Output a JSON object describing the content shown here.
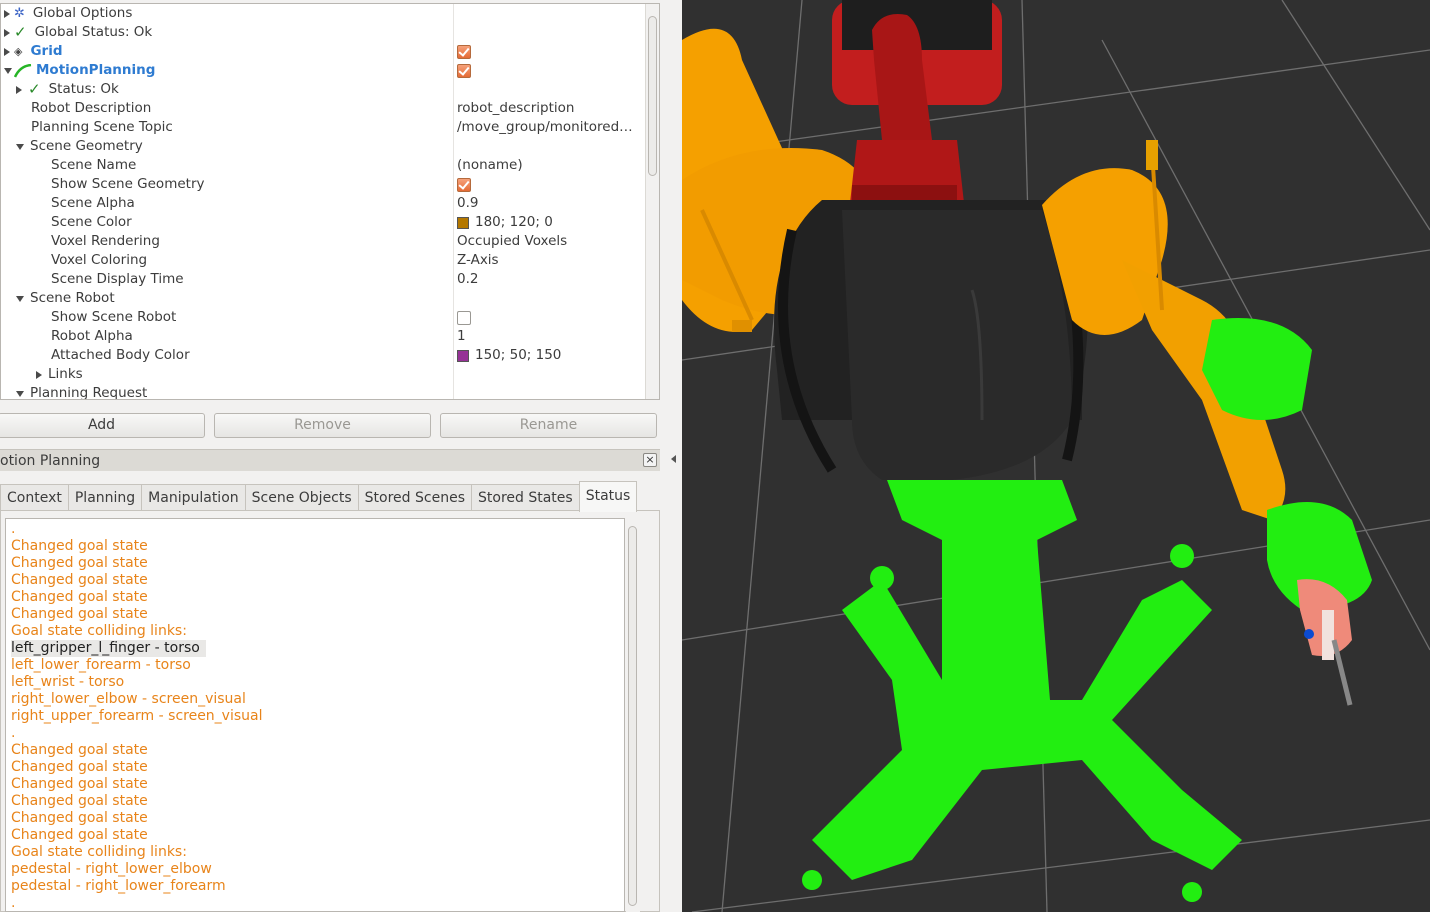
{
  "tree": {
    "rows": [
      {
        "icon": "gear-icon",
        "label": "Global Options",
        "value": ""
      },
      {
        "icon": "check-icon",
        "label": "Global Status: Ok",
        "value": ""
      },
      {
        "icon": "grid-icon",
        "label": "Grid",
        "value": "checked"
      },
      {
        "icon": "motion-planning-icon",
        "label": "MotionPlanning",
        "value": "checked"
      },
      {
        "icon": "check-icon",
        "label": "Status: Ok",
        "value": ""
      },
      {
        "label": "Robot Description",
        "value": "robot_description"
      },
      {
        "label": "Planning Scene Topic",
        "value": "/move_group/monitored…"
      },
      {
        "label": "Scene Geometry",
        "value": ""
      },
      {
        "label": "Scene Name",
        "value": "(noname)"
      },
      {
        "label": "Show Scene Geometry",
        "value": "checked"
      },
      {
        "label": "Scene Alpha",
        "value": "0.9"
      },
      {
        "label": "Scene Color",
        "value": "180; 120; 0",
        "swatch": "#b47800"
      },
      {
        "label": "Voxel Rendering",
        "value": "Occupied Voxels"
      },
      {
        "label": "Voxel Coloring",
        "value": "Z-Axis"
      },
      {
        "label": "Scene Display Time",
        "value": "0.2"
      },
      {
        "label": "Scene Robot",
        "value": ""
      },
      {
        "label": "Show Scene Robot",
        "value": "unchecked"
      },
      {
        "label": "Robot Alpha",
        "value": "1"
      },
      {
        "label": "Attached Body Color",
        "value": "150; 50; 150",
        "swatch": "#963296"
      },
      {
        "label": "Links",
        "value": ""
      },
      {
        "label": "Planning Request",
        "value": ""
      }
    ]
  },
  "buttons": {
    "add": "Add",
    "remove": "Remove",
    "rename": "Rename"
  },
  "panel": {
    "title": "otion Planning",
    "close": "×"
  },
  "tabs": [
    "Context",
    "Planning",
    "Manipulation",
    "Scene Objects",
    "Stored Scenes",
    "Stored States",
    "Status"
  ],
  "log": [
    ".",
    "Changed goal state",
    "Changed goal state",
    "Changed goal state",
    "Changed goal state",
    "Changed goal state",
    "Goal state colliding links:",
    "left_gripper_l_finger - torso",
    "left_lower_forearm - torso",
    "left_wrist - torso",
    "right_lower_elbow - screen_visual",
    "right_upper_forearm - screen_visual",
    ".",
    "Changed goal state",
    "Changed goal state",
    "Changed goal state",
    "Changed goal state",
    "Changed goal state",
    "Changed goal state",
    "Goal state colliding links:",
    "pedestal - right_lower_elbow",
    "pedestal - right_lower_forearm",
    "."
  ],
  "colors": {
    "log_text": "#e8841a",
    "robot_orange": "#f5a000",
    "collision_green": "#22ee11",
    "torso_red": "#b51a1a",
    "background": "#303030"
  }
}
